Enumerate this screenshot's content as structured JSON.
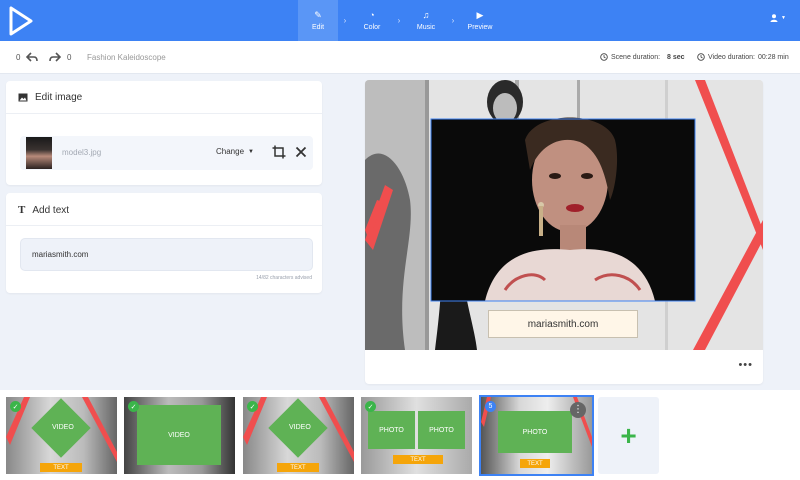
{
  "header": {
    "steps": [
      {
        "label": "Edit",
        "icon": "pencil-icon",
        "active": true
      },
      {
        "label": "Color",
        "icon": "palette-icon",
        "active": false
      },
      {
        "label": "Music",
        "icon": "music-note-icon",
        "active": false
      },
      {
        "label": "Preview",
        "icon": "play-icon",
        "active": false
      }
    ],
    "separator": "›",
    "user_icon": "user-icon"
  },
  "toolbar": {
    "undo_count": "0",
    "redo_count": "0",
    "project_name": "Fashion Kaleidoscope",
    "scene_duration_label": "Scene duration:",
    "scene_duration_value": "8 sec",
    "video_duration_label": "Video duration:",
    "video_duration_value": "00:28 min"
  },
  "edit_image": {
    "title": "Edit image",
    "filename": "model3.jpg",
    "change_label": "Change"
  },
  "add_text": {
    "title": "Add text",
    "value": "mariasmith.com",
    "hint": "14/82 characters advised"
  },
  "preview": {
    "caption": "mariasmith.com",
    "more": "•••"
  },
  "timeline": {
    "clips": [
      {
        "type": "video-diamond",
        "label": "VIDEO",
        "tag": "TEXT",
        "status": "done"
      },
      {
        "type": "video-rect",
        "label": "VIDEO",
        "tag": "",
        "status": "done"
      },
      {
        "type": "video-diamond",
        "label": "VIDEO",
        "tag": "TEXT",
        "status": "done"
      },
      {
        "type": "photo-double",
        "label": "PHOTO",
        "label2": "PHOTO",
        "tag": "TEXT",
        "status": "done"
      },
      {
        "type": "photo-rect",
        "label": "PHOTO",
        "tag": "TEXT",
        "status": "current",
        "number": "5"
      }
    ],
    "add_label": "+"
  },
  "colors": {
    "accent": "#3d82f4",
    "green": "#5fb255",
    "orange": "#f5a50a",
    "red_stripe": "#f04e4e"
  }
}
